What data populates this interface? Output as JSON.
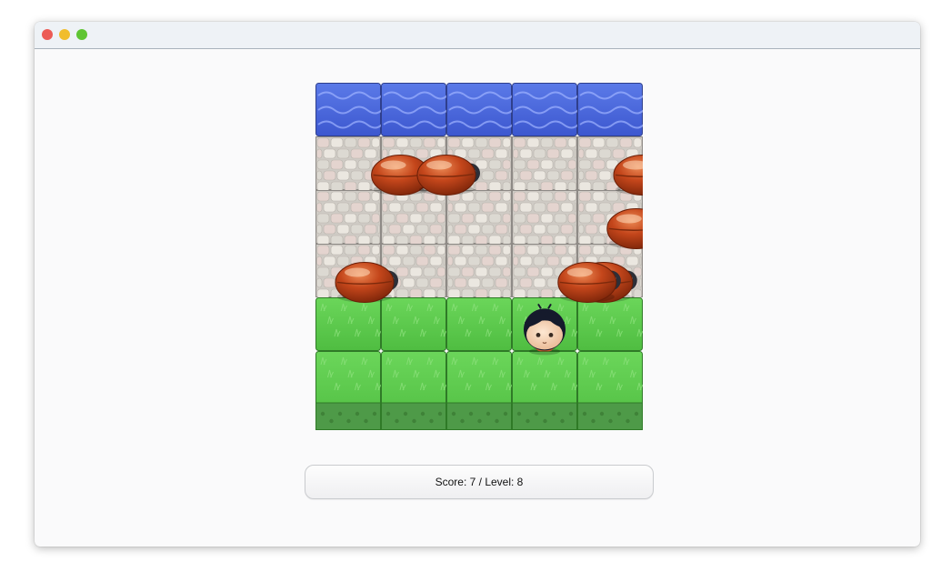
{
  "window": {
    "title_bar_buttons": [
      "close",
      "minimize",
      "maximize"
    ]
  },
  "game": {
    "grid": {
      "columns": 5,
      "rows": [
        [
          "water",
          "water",
          "water",
          "water",
          "water"
        ],
        [
          "stone",
          "stone",
          "stone",
          "stone",
          "stone"
        ],
        [
          "stone",
          "stone",
          "stone",
          "stone",
          "stone"
        ],
        [
          "stone",
          "stone",
          "stone",
          "stone",
          "stone"
        ],
        [
          "grass",
          "grass",
          "grass",
          "grass",
          "grass"
        ],
        [
          "grass",
          "grass",
          "grass",
          "grass",
          "grass"
        ]
      ]
    },
    "player": {
      "name": "boy-character",
      "column": 3,
      "row": 4
    },
    "enemies": [
      {
        "name": "enemy-bug",
        "row": 1,
        "column": 0.8,
        "facing": "right"
      },
      {
        "name": "enemy-bug",
        "row": 1,
        "column": 1.5,
        "facing": "right"
      },
      {
        "name": "enemy-bug",
        "row": 1,
        "column": 4.5,
        "facing": "right"
      },
      {
        "name": "enemy-bug",
        "row": 2,
        "column": 4.4,
        "facing": "right"
      },
      {
        "name": "enemy-bug",
        "row": 3,
        "column": 0.25,
        "facing": "right"
      },
      {
        "name": "enemy-bug",
        "row": 3,
        "column": 3.9,
        "facing": "right"
      },
      {
        "name": "enemy-bug",
        "row": 3,
        "column": 3.65,
        "facing": "right"
      }
    ],
    "colors": {
      "water": "#4f6de0",
      "stone": "#dedbd6",
      "grass": "#5fcf4f",
      "bug": "#c4461b"
    }
  },
  "status": {
    "text": "Score: 7 / Level: 8"
  }
}
